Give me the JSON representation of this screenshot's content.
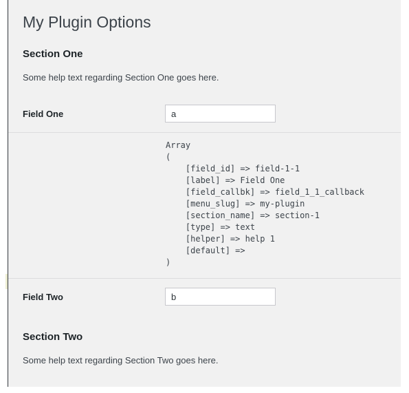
{
  "page": {
    "title": "My Plugin Options"
  },
  "sections": [
    {
      "heading": "Section One",
      "help_text": "Some help text regarding Section One goes here."
    },
    {
      "heading": "Section Two",
      "help_text": "Some help text regarding Section Two goes here."
    }
  ],
  "fields": [
    {
      "label": "Field One",
      "value": "a",
      "placeholder": ""
    },
    {
      "label": "Field Two",
      "value": "b",
      "placeholder": ""
    }
  ],
  "debug_dump": "Array\n(\n    [field_id] => field-1-1\n    [label] => Field One\n    [field_callbk] => field_1_1_callback\n    [menu_slug] => my-plugin\n    [section_name] => section-1\n    [type] => text\n    [helper] => help 1\n    [default] => \n)",
  "colors": {
    "page_background": "#f1f1f1",
    "canvas_background": "#ffffff",
    "rail": "#32373c",
    "rail_marker": "#e8e7c8",
    "title_text": "#3c434a",
    "heading_text": "#1d2327",
    "body_text": "#3c434a",
    "input_border": "#c7c7cc",
    "divider": "#dcdcde"
  }
}
